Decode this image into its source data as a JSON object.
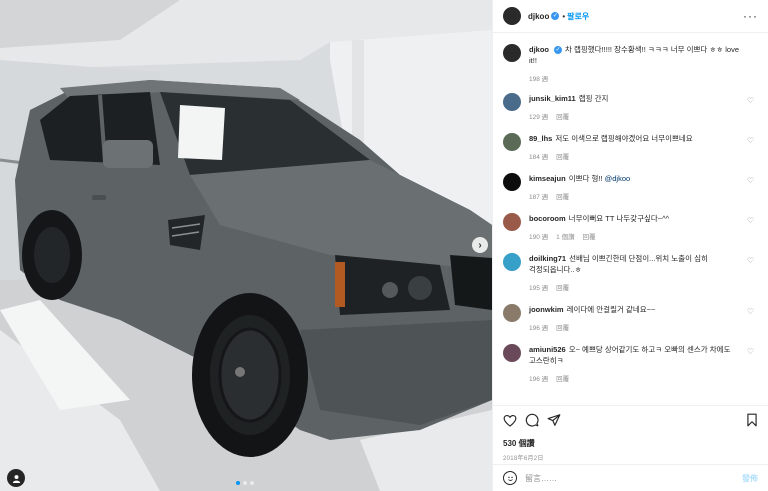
{
  "post": {
    "author": "djkoo",
    "follow_label": "팔로우",
    "verified_glyph": "✓",
    "more_glyph": "···",
    "caption_text": "차 랩핑했다!!!!! 장수황색!! ㅋㅋㅋ 너무 이쁘다 ㅎㅎ love it!!",
    "caption_time": "198 週",
    "likes": "530 個讚",
    "date": "2018年6月2日"
  },
  "comments": [
    {
      "user": "junsik_kim11",
      "text": "랩핑 간지",
      "time": "129 週",
      "reply": "回覆",
      "likes": "",
      "avatar_color": "#4a6b8a"
    },
    {
      "user": "89_lhs",
      "text": "저도 이색으로 랩핑해야겠어요 너무이쁘네요",
      "time": "184 週",
      "reply": "回覆",
      "likes": "",
      "avatar_color": "#5a6a55"
    },
    {
      "user": "kimseajun",
      "text": "이쁘다 형!! ",
      "mention": "@djkoo",
      "time": "187 週",
      "reply": "回覆",
      "likes": "",
      "avatar_color": "#0d0d0d"
    },
    {
      "user": "bocoroom",
      "text": "너무이뻐요 TT 나두갖구싶다~^^",
      "time": "190 週",
      "reply": "回覆",
      "likes": "1 個讚",
      "avatar_color": "#9a5a4a"
    },
    {
      "user": "doilking71",
      "text": "선배님 이쁘긴한데 단점이...위치 노출이 심히 걱정되옵니다..ㅎ",
      "time": "195 週",
      "reply": "回覆",
      "likes": "",
      "avatar_color": "#37a0c9"
    },
    {
      "user": "joonwkim",
      "text": "레이다에 안걸릴거 같네요~~",
      "time": "196 週",
      "reply": "回覆",
      "likes": "",
      "avatar_color": "#8a7a6a"
    },
    {
      "user": "amiuni526",
      "text": "오~ 예쁘당 상어같기도 하고ㅋ 오빠의 센스가 차에도 고스란히ㅋ",
      "time": "196 週",
      "reply": "回覆",
      "likes": "",
      "avatar_color": "#6a4a5a"
    }
  ],
  "compose": {
    "placeholder": "留言……",
    "post_label": "發佈"
  },
  "icons": [
    "heart-icon",
    "comment-icon",
    "share-icon",
    "bookmark-icon",
    "emoji-icon",
    "tag-user-icon",
    "chevron-right-icon",
    "more-icon",
    "verified-icon"
  ],
  "colors": {
    "accent": "#0095f6",
    "verified": "#3897f0",
    "muted": "#8e8e8e",
    "car_body": "#5f6566"
  }
}
